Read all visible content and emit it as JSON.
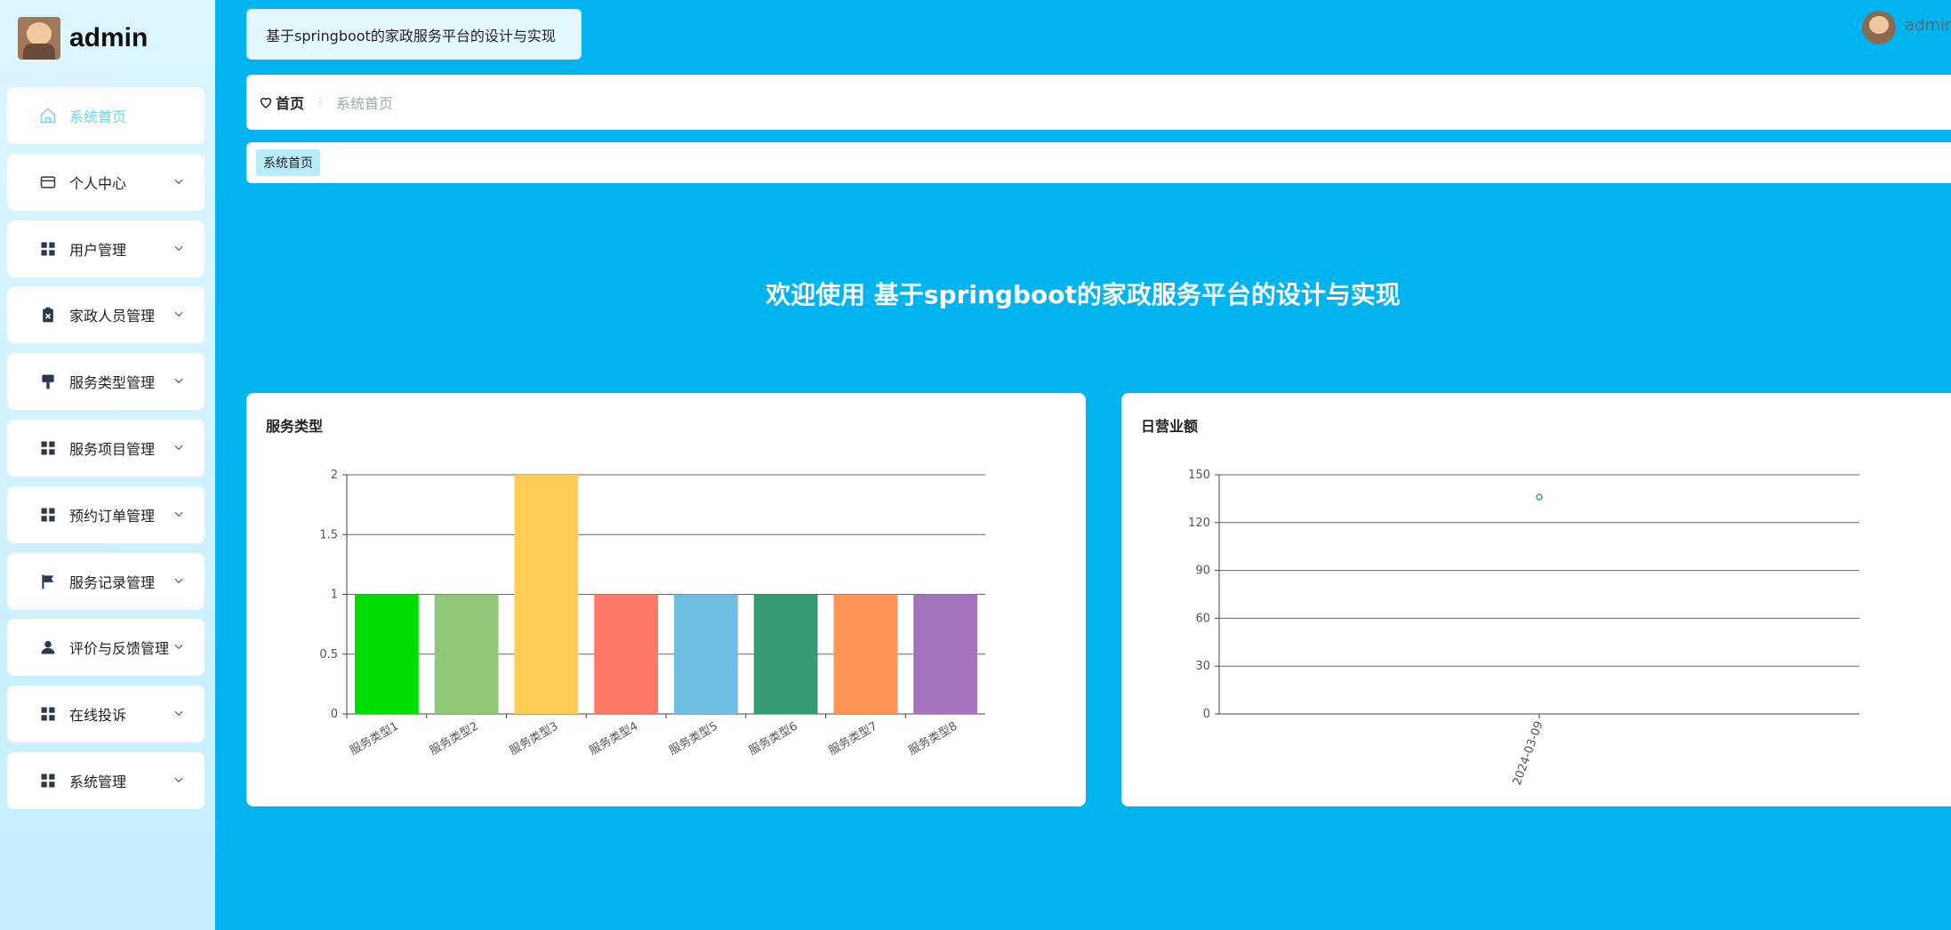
{
  "brand": {
    "name": "admin"
  },
  "header": {
    "title": "基于springboot的家政服务平台的设计与实现",
    "user": "admin"
  },
  "sidebar": {
    "items": [
      {
        "label": "系统首页",
        "icon": "home-icon",
        "active": true
      },
      {
        "label": "个人中心",
        "icon": "card-icon"
      },
      {
        "label": "用户管理",
        "icon": "grid-icon"
      },
      {
        "label": "家政人员管理",
        "icon": "clipboard-icon"
      },
      {
        "label": "服务类型管理",
        "icon": "brush-icon"
      },
      {
        "label": "服务项目管理",
        "icon": "grid-icon"
      },
      {
        "label": "预约订单管理",
        "icon": "grid-icon"
      },
      {
        "label": "服务记录管理",
        "icon": "flag-icon"
      },
      {
        "label": "评价与反馈管理",
        "icon": "user-icon"
      },
      {
        "label": "在线投诉",
        "icon": "grid-icon"
      },
      {
        "label": "系统管理",
        "icon": "grid-icon"
      }
    ]
  },
  "breadcrumb": {
    "home": "首页",
    "current": "系统首页"
  },
  "tabs": [
    {
      "label": "系统首页"
    }
  ],
  "welcome": "欢迎使用 基于springboot的家政服务平台的设计与实现",
  "chart_data": [
    {
      "type": "bar",
      "title": "服务类型",
      "categories": [
        "服务类型1",
        "服务类型2",
        "服务类型3",
        "服务类型4",
        "服务类型5",
        "服务类型6",
        "服务类型7",
        "服务类型8"
      ],
      "values": [
        1,
        1,
        2,
        1,
        1,
        1,
        1,
        1
      ],
      "colors": [
        "#00dd00",
        "#91c877",
        "#ffcc55",
        "#ff7766",
        "#70bde3",
        "#379a74",
        "#ff9455",
        "#a374bd"
      ],
      "ylim": [
        0,
        2
      ],
      "yticks": [
        0,
        0.5,
        1,
        1.5,
        2
      ],
      "grid": true
    },
    {
      "type": "scatter",
      "title": "日营业额",
      "x": [
        "2024-03-09"
      ],
      "values": [
        136
      ],
      "color": "#5a7cc8",
      "ylim": [
        0,
        150
      ],
      "yticks": [
        0,
        30,
        60,
        90,
        120,
        150
      ],
      "grid": true
    }
  ]
}
